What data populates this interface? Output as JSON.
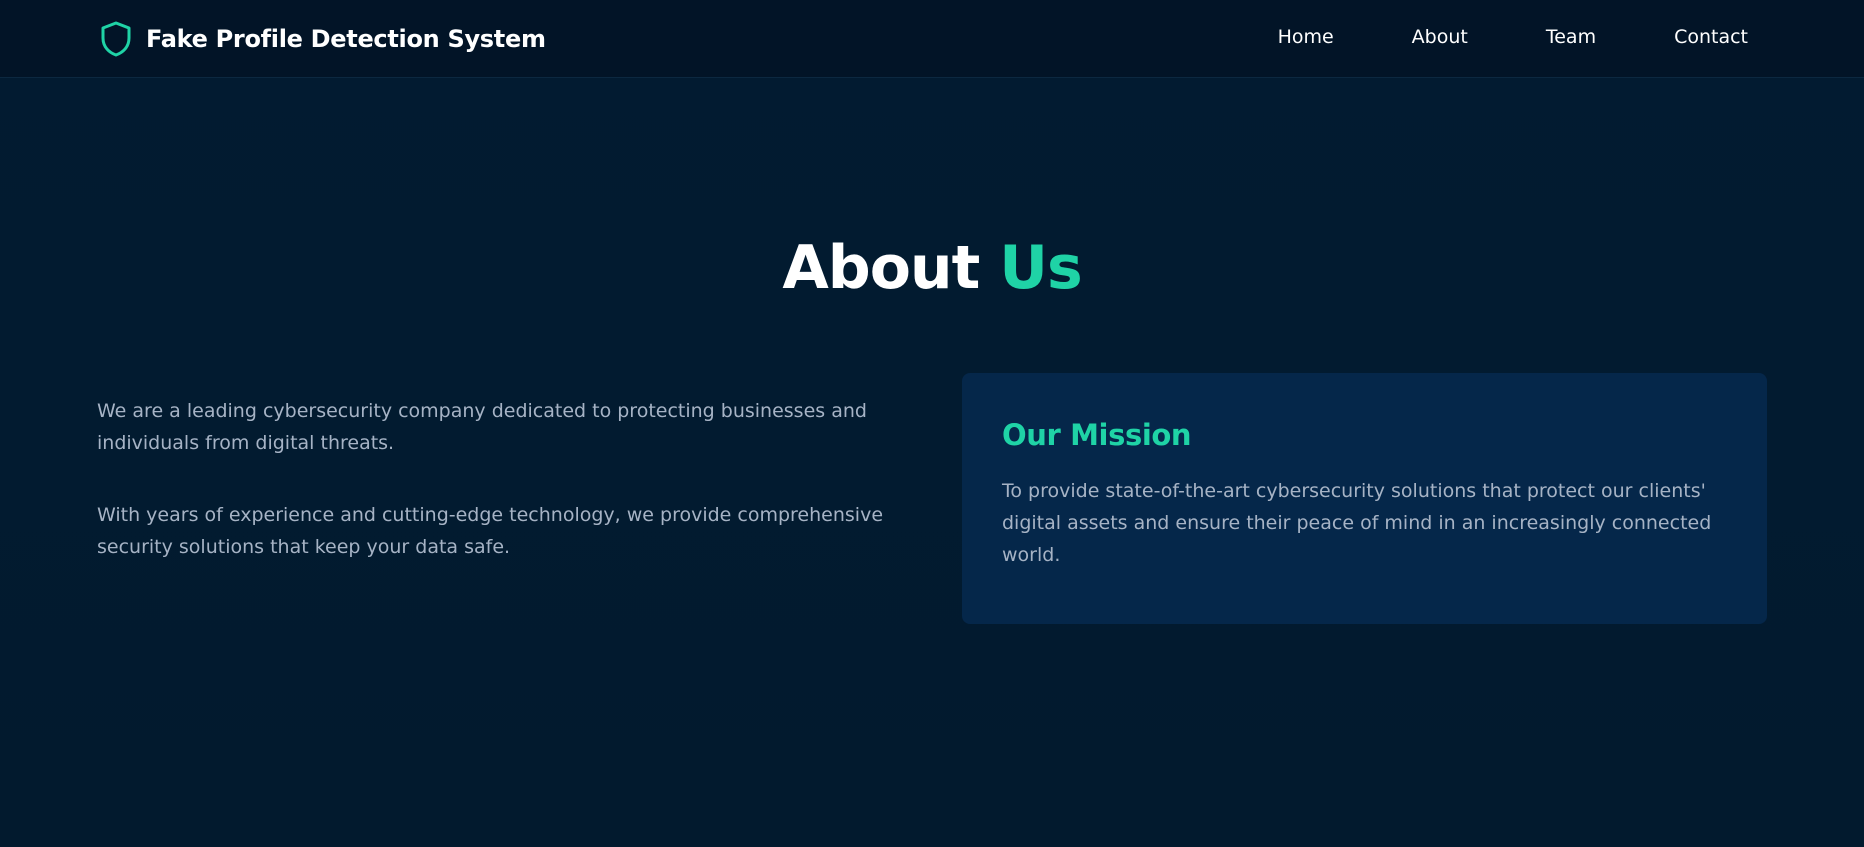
{
  "header": {
    "brand_icon": "shield-icon",
    "brand_title": "Fake Profile Detection System",
    "nav": [
      {
        "label": "Home"
      },
      {
        "label": "About"
      },
      {
        "label": "Team"
      },
      {
        "label": "Contact"
      }
    ]
  },
  "about": {
    "heading_main": "About",
    "heading_accent": "Us",
    "paragraphs": [
      "We are a leading cybersecurity company dedicated to protecting businesses and individuals from digital threats.",
      "With years of experience and cutting-edge technology, we provide comprehensive security solutions that keep your data safe."
    ]
  },
  "mission": {
    "title": "Our Mission",
    "text": "To provide state-of-the-art cybersecurity solutions that protect our clients' digital assets and ensure their peace of mind in an increasingly connected world."
  },
  "colors": {
    "background": "#021b30",
    "header_background": "#021427",
    "card_background": "#05274a",
    "accent": "#1fd3a6",
    "body_text": "#a6b3c5",
    "heading_text": "#ffffff"
  }
}
